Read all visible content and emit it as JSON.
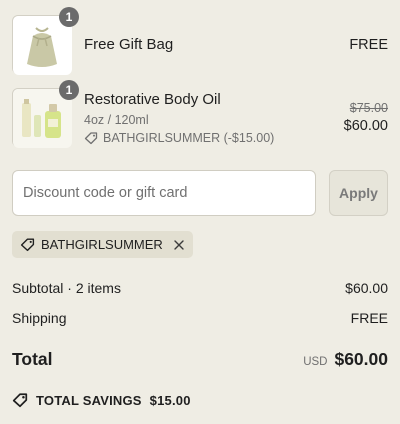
{
  "line_items": [
    {
      "name": "Free Gift Bag",
      "quantity": "1",
      "price": "FREE",
      "thumbnail_icon": "gift-bag-icon"
    },
    {
      "name": "Restorative Body Oil",
      "quantity": "1",
      "variant": "4oz / 120ml",
      "applied_discount": "BATHGIRLSUMMER (-$15.00)",
      "original_price": "$75.00",
      "price": "$60.00",
      "thumbnail_icon": "body-oil-bottles-icon"
    }
  ],
  "discount": {
    "placeholder": "Discount code or gift card",
    "value": "",
    "apply_label": "Apply"
  },
  "applied_code": {
    "code": "BATHGIRLSUMMER",
    "tag_icon": "tag-icon",
    "remove_icon": "close-icon"
  },
  "summary": {
    "subtotal_label": "Subtotal · 2 items",
    "subtotal_value": "$60.00",
    "shipping_label": "Shipping",
    "shipping_value": "FREE",
    "total_label": "Total",
    "currency": "USD",
    "total_value": "$60.00"
  },
  "savings": {
    "label": "TOTAL SAVINGS",
    "value": "$15.00",
    "icon": "savings-tag-icon"
  },
  "colors": {
    "background": "#efede4",
    "chip_background": "#e2dfd1",
    "quantity_badge": "#6b6b6b",
    "muted_text": "#707070"
  }
}
